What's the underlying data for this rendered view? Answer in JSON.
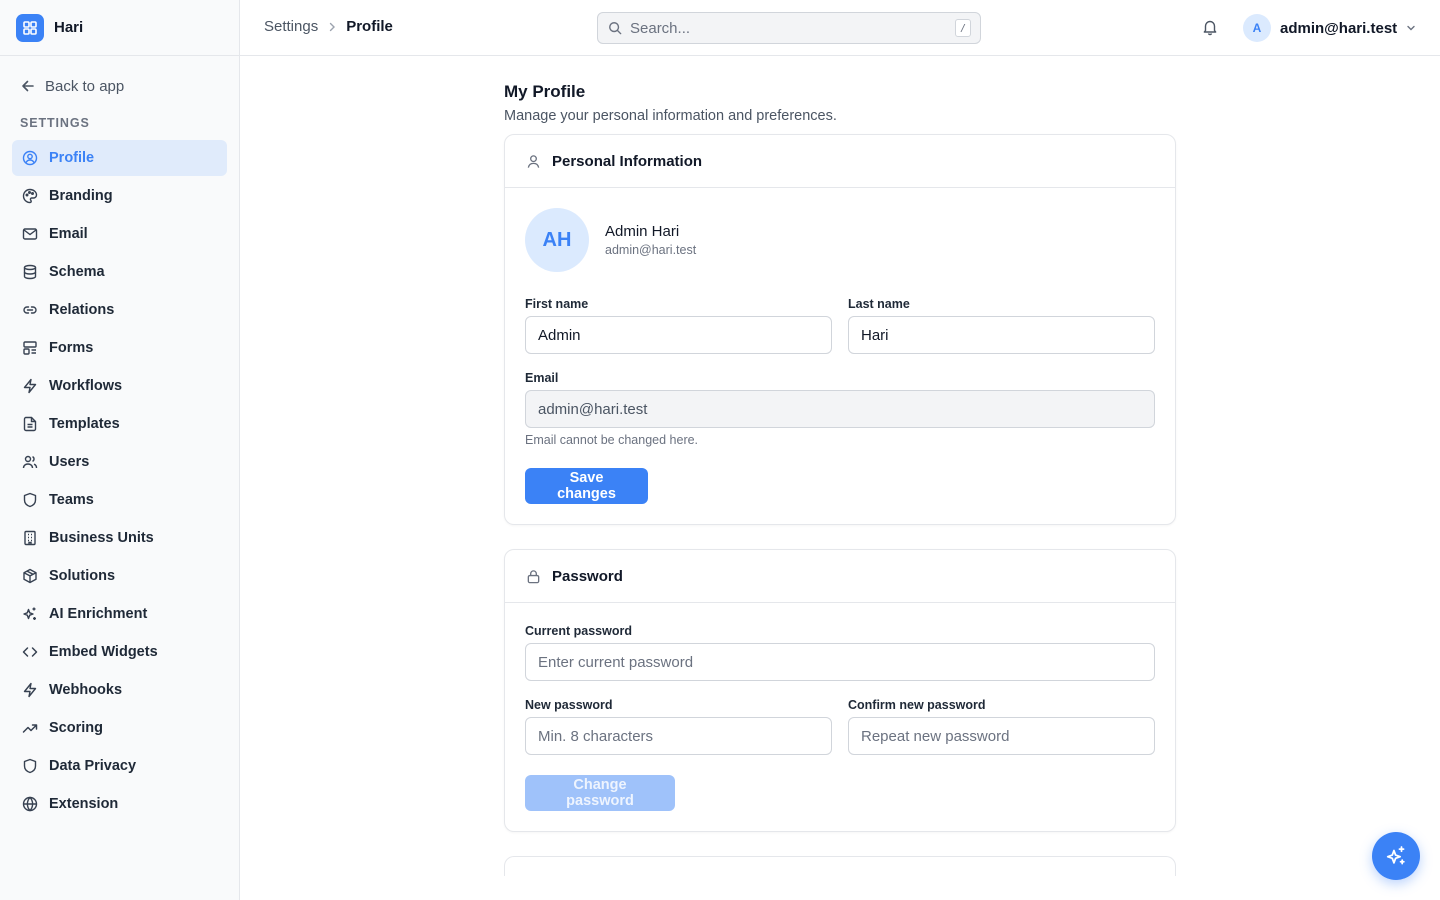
{
  "app": {
    "name": "Hari"
  },
  "sidebar": {
    "back_label": "Back to app",
    "section_label": "SETTINGS",
    "items": [
      {
        "label": "Profile",
        "icon": "user-circle-icon",
        "active": true
      },
      {
        "label": "Branding",
        "icon": "palette-icon"
      },
      {
        "label": "Email",
        "icon": "mail-icon"
      },
      {
        "label": "Schema",
        "icon": "database-icon"
      },
      {
        "label": "Relations",
        "icon": "link-icon"
      },
      {
        "label": "Forms",
        "icon": "layout-icon"
      },
      {
        "label": "Workflows",
        "icon": "zap-icon"
      },
      {
        "label": "Templates",
        "icon": "file-text-icon"
      },
      {
        "label": "Users",
        "icon": "users-icon"
      },
      {
        "label": "Teams",
        "icon": "shield-icon"
      },
      {
        "label": "Business Units",
        "icon": "building-icon"
      },
      {
        "label": "Solutions",
        "icon": "package-icon"
      },
      {
        "label": "AI Enrichment",
        "icon": "sparkles-icon"
      },
      {
        "label": "Embed Widgets",
        "icon": "code-icon"
      },
      {
        "label": "Webhooks",
        "icon": "zap-icon"
      },
      {
        "label": "Scoring",
        "icon": "trending-up-icon"
      },
      {
        "label": "Data Privacy",
        "icon": "shield-icon"
      },
      {
        "label": "Extension",
        "icon": "globe-icon"
      }
    ]
  },
  "header": {
    "breadcrumb_root": "Settings",
    "breadcrumb_current": "Profile",
    "search_placeholder": "Search...",
    "search_shortcut": "/",
    "user_initial": "A",
    "user_email": "admin@hari.test"
  },
  "page": {
    "title": "My Profile",
    "subtitle": "Manage your personal information and preferences."
  },
  "personal": {
    "title": "Personal Information",
    "initials": "AH",
    "name": "Admin Hari",
    "email": "admin@hari.test",
    "first_name_label": "First name",
    "first_name_value": "Admin",
    "last_name_label": "Last name",
    "last_name_value": "Hari",
    "email_label": "Email",
    "email_value": "admin@hari.test",
    "email_hint": "Email cannot be changed here.",
    "save_label": "Save changes"
  },
  "password": {
    "title": "Password",
    "current_label": "Current password",
    "current_placeholder": "Enter current password",
    "new_label": "New password",
    "new_placeholder": "Min. 8 characters",
    "confirm_label": "Confirm new password",
    "confirm_placeholder": "Repeat new password",
    "change_label": "Change password"
  },
  "colors": {
    "accent": "#3b82f6",
    "accent_light": "#dbeafe",
    "active_bg": "#e0ebfb"
  }
}
